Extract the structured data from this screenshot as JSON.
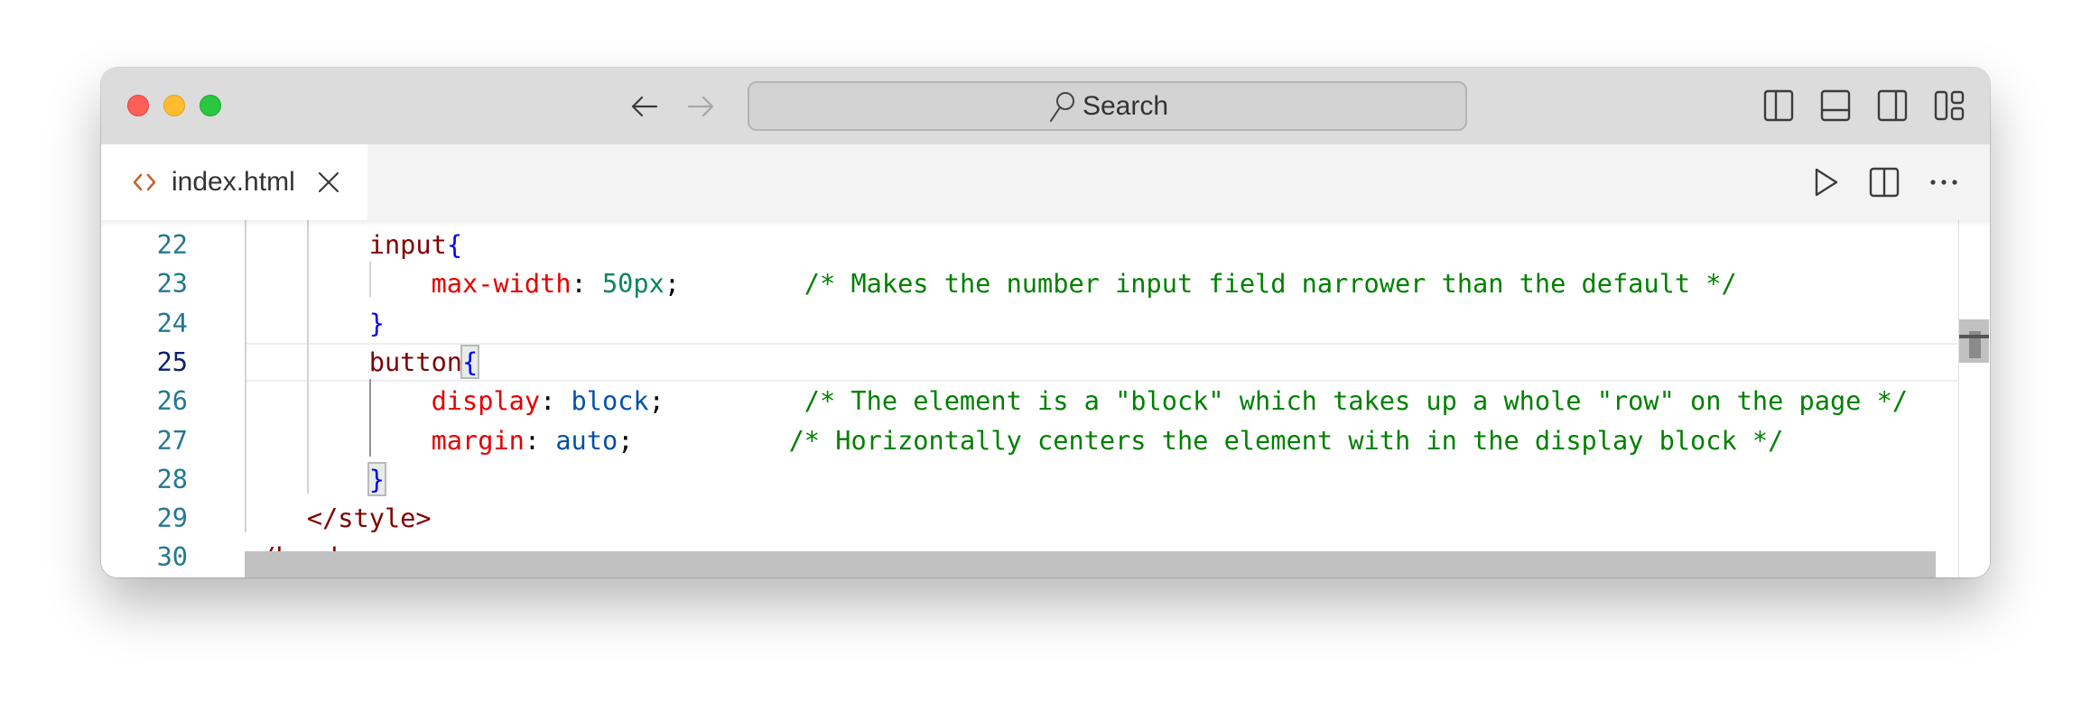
{
  "window": {
    "controls": [
      "close",
      "minimize",
      "zoom"
    ]
  },
  "titlebar": {
    "back_icon": "arrow-left-icon",
    "forward_icon": "arrow-right-icon",
    "search": {
      "icon": "search-icon",
      "label": "Search"
    },
    "layout_icons": [
      "toggle-primary-sidebar-icon",
      "toggle-panel-icon",
      "toggle-secondary-sidebar-icon",
      "customize-layout-icon"
    ]
  },
  "tabs": [
    {
      "label": "index.html",
      "icon": "html-file-icon",
      "active": true,
      "close_icon": "close-icon"
    }
  ],
  "tab_actions": [
    "run-icon",
    "split-editor-icon",
    "more-actions-icon"
  ],
  "editor": {
    "current_line": 25,
    "lines": [
      {
        "num": "22",
        "tokens": [
          {
            "t": "        ",
            "c": ""
          },
          {
            "t": "input",
            "c": "t-tag"
          },
          {
            "t": "{",
            "c": "t-brace"
          }
        ]
      },
      {
        "num": "23",
        "tokens": [
          {
            "t": "            ",
            "c": ""
          },
          {
            "t": "max-width",
            "c": "t-prop"
          },
          {
            "t": ": ",
            "c": "t-punc"
          },
          {
            "t": "50px",
            "c": "t-num"
          },
          {
            "t": ";",
            "c": "t-punc"
          },
          {
            "t": "        ",
            "c": ""
          },
          {
            "t": "/* Makes the number input field narrower than the default */",
            "c": "t-cmt"
          }
        ]
      },
      {
        "num": "24",
        "tokens": [
          {
            "t": "        ",
            "c": ""
          },
          {
            "t": "}",
            "c": "t-brace"
          }
        ]
      },
      {
        "num": "25",
        "tokens": [
          {
            "t": "        ",
            "c": ""
          },
          {
            "t": "button",
            "c": "t-tag"
          },
          {
            "t": "{",
            "c": "t-brace brk-match"
          }
        ]
      },
      {
        "num": "26",
        "tokens": [
          {
            "t": "            ",
            "c": ""
          },
          {
            "t": "display",
            "c": "t-prop"
          },
          {
            "t": ": ",
            "c": "t-punc"
          },
          {
            "t": "block",
            "c": "t-val"
          },
          {
            "t": ";",
            "c": "t-punc"
          },
          {
            "t": "         ",
            "c": ""
          },
          {
            "t": "/* The element is a \"block\" which takes up a whole \"row\" on the page */",
            "c": "t-cmt"
          }
        ]
      },
      {
        "num": "27",
        "tokens": [
          {
            "t": "            ",
            "c": ""
          },
          {
            "t": "margin",
            "c": "t-prop"
          },
          {
            "t": ": ",
            "c": "t-punc"
          },
          {
            "t": "auto",
            "c": "t-val"
          },
          {
            "t": ";",
            "c": "t-punc"
          },
          {
            "t": "          ",
            "c": ""
          },
          {
            "t": "/* Horizontally centers the element with in the display block */",
            "c": "t-cmt"
          }
        ]
      },
      {
        "num": "28",
        "tokens": [
          {
            "t": "        ",
            "c": ""
          },
          {
            "t": "}",
            "c": "t-brace brk-match"
          }
        ]
      },
      {
        "num": "29",
        "tokens": [
          {
            "t": "    ",
            "c": ""
          },
          {
            "t": "</style>",
            "c": "t-tag"
          }
        ]
      },
      {
        "num": "30",
        "tokens": [
          {
            "t": "</head>",
            "c": "t-tag"
          }
        ]
      }
    ]
  },
  "colors": {
    "line_number": "#237893",
    "line_number_active": "#0b216f",
    "tag": "#800000",
    "brace": "#0000ff",
    "property": "#e50000",
    "number": "#098658",
    "value": "#0451a5",
    "comment": "#008000",
    "html_icon": "#c5652d"
  }
}
